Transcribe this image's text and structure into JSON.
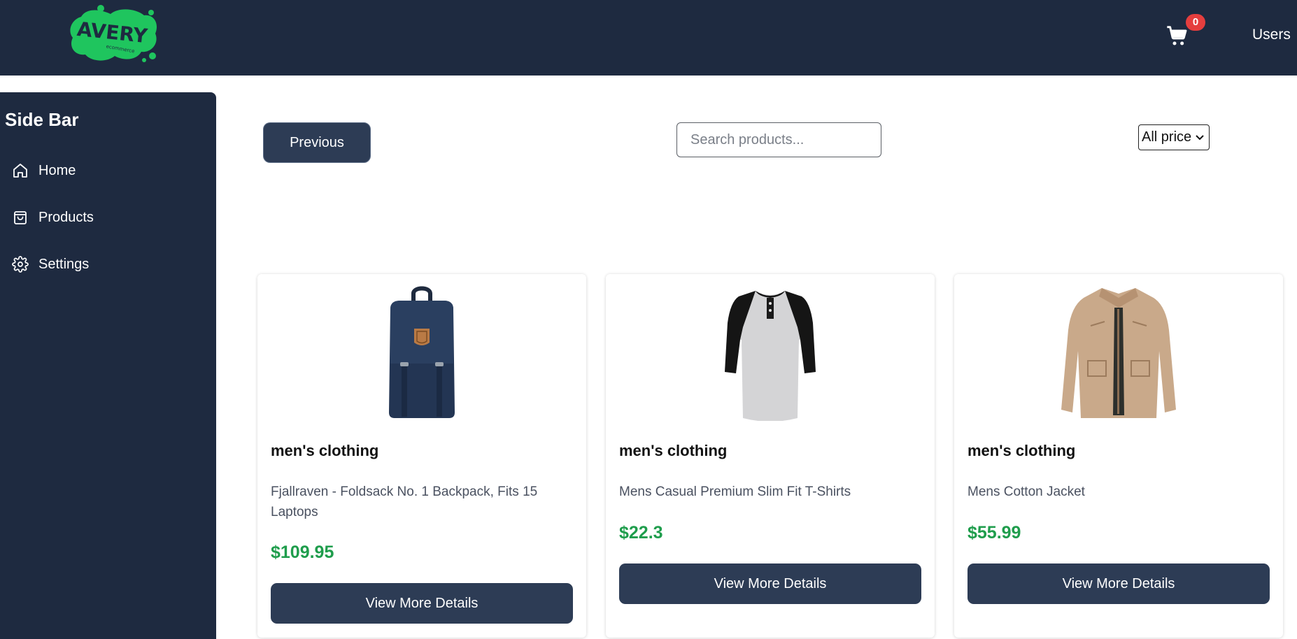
{
  "header": {
    "logo_text": "AVERY",
    "logo_subtext": "ecommerce",
    "cart_count": "0",
    "users_label": "Users",
    "accent_color": "#1fc55e",
    "bg_color": "#1e2a40"
  },
  "sidebar": {
    "title": "Side Bar",
    "items": [
      {
        "label": "Home",
        "icon": "home-icon"
      },
      {
        "label": "Products",
        "icon": "shopping-bag-icon"
      },
      {
        "label": "Settings",
        "icon": "gear-icon"
      }
    ]
  },
  "toolbar": {
    "previous_label": "Previous",
    "search_placeholder": "Search products...",
    "search_value": "",
    "price_filter_selected": "All price"
  },
  "products": [
    {
      "category": "men's clothing",
      "title": "Fjallraven - Foldsack No. 1 Backpack, Fits 15 Laptops",
      "price": "$109.95",
      "button_label": "View More Details",
      "image": "backpack-image"
    },
    {
      "category": "men's clothing",
      "title": "Mens Casual Premium Slim Fit T-Shirts",
      "price": "$22.3",
      "button_label": "View More Details",
      "image": "tshirt-image"
    },
    {
      "category": "men's clothing",
      "title": "Mens Cotton Jacket",
      "price": "$55.99",
      "button_label": "View More Details",
      "image": "jacket-image"
    }
  ]
}
